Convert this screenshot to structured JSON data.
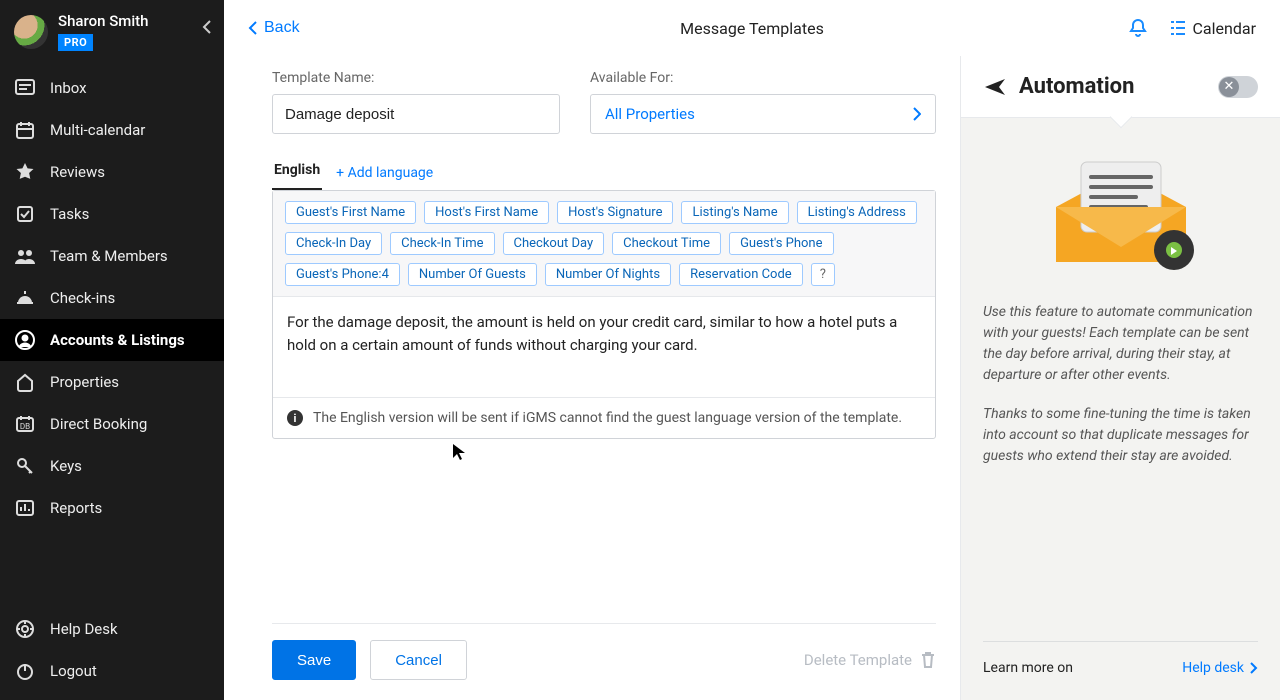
{
  "user": {
    "name": "Sharon Smith",
    "badge": "PRO"
  },
  "sidebar": {
    "items": [
      {
        "label": "Inbox"
      },
      {
        "label": "Multi-calendar"
      },
      {
        "label": "Reviews"
      },
      {
        "label": "Tasks"
      },
      {
        "label": "Team & Members"
      },
      {
        "label": "Check-ins"
      },
      {
        "label": "Accounts & Listings"
      },
      {
        "label": "Properties"
      },
      {
        "label": "Direct Booking"
      },
      {
        "label": "Keys"
      },
      {
        "label": "Reports"
      }
    ],
    "bottom": [
      {
        "label": "Help Desk"
      },
      {
        "label": "Logout"
      }
    ]
  },
  "topbar": {
    "back": "Back",
    "title": "Message Templates",
    "calendar": "Calendar"
  },
  "form": {
    "template_name_label": "Template Name:",
    "template_name_value": "Damage deposit",
    "available_for_label": "Available For:",
    "available_for_value": "All Properties",
    "lang_tab": "English",
    "add_language": "+ Add language",
    "tokens": [
      "Guest's First Name",
      "Host's First Name",
      "Host's Signature",
      "Listing's Name",
      "Listing's Address",
      "Check-In Day",
      "Check-In Time",
      "Checkout Day",
      "Checkout Time",
      "Guest's Phone",
      "Guest's Phone:4",
      "Number Of Guests",
      "Number Of Nights",
      "Reservation Code"
    ],
    "token_help": "?",
    "body": "For the damage deposit, the amount is held on your credit card, similar to how a hotel puts a hold on a certain amount of funds without charging your card.",
    "note": "The English version will be sent if iGMS cannot find the guest language version of the template.",
    "save": "Save",
    "cancel": "Cancel",
    "delete": "Delete Template"
  },
  "automation": {
    "title": "Automation",
    "p1": "Use this feature to automate communication with your guests! Each template can be sent the day before arrival, during their stay, at departure or after other events.",
    "p2": "Thanks to some fine-tuning the time is taken into account so that duplicate messages for guests who extend their stay are avoided.",
    "learn_label": "Learn more on",
    "help_link": "Help desk"
  }
}
